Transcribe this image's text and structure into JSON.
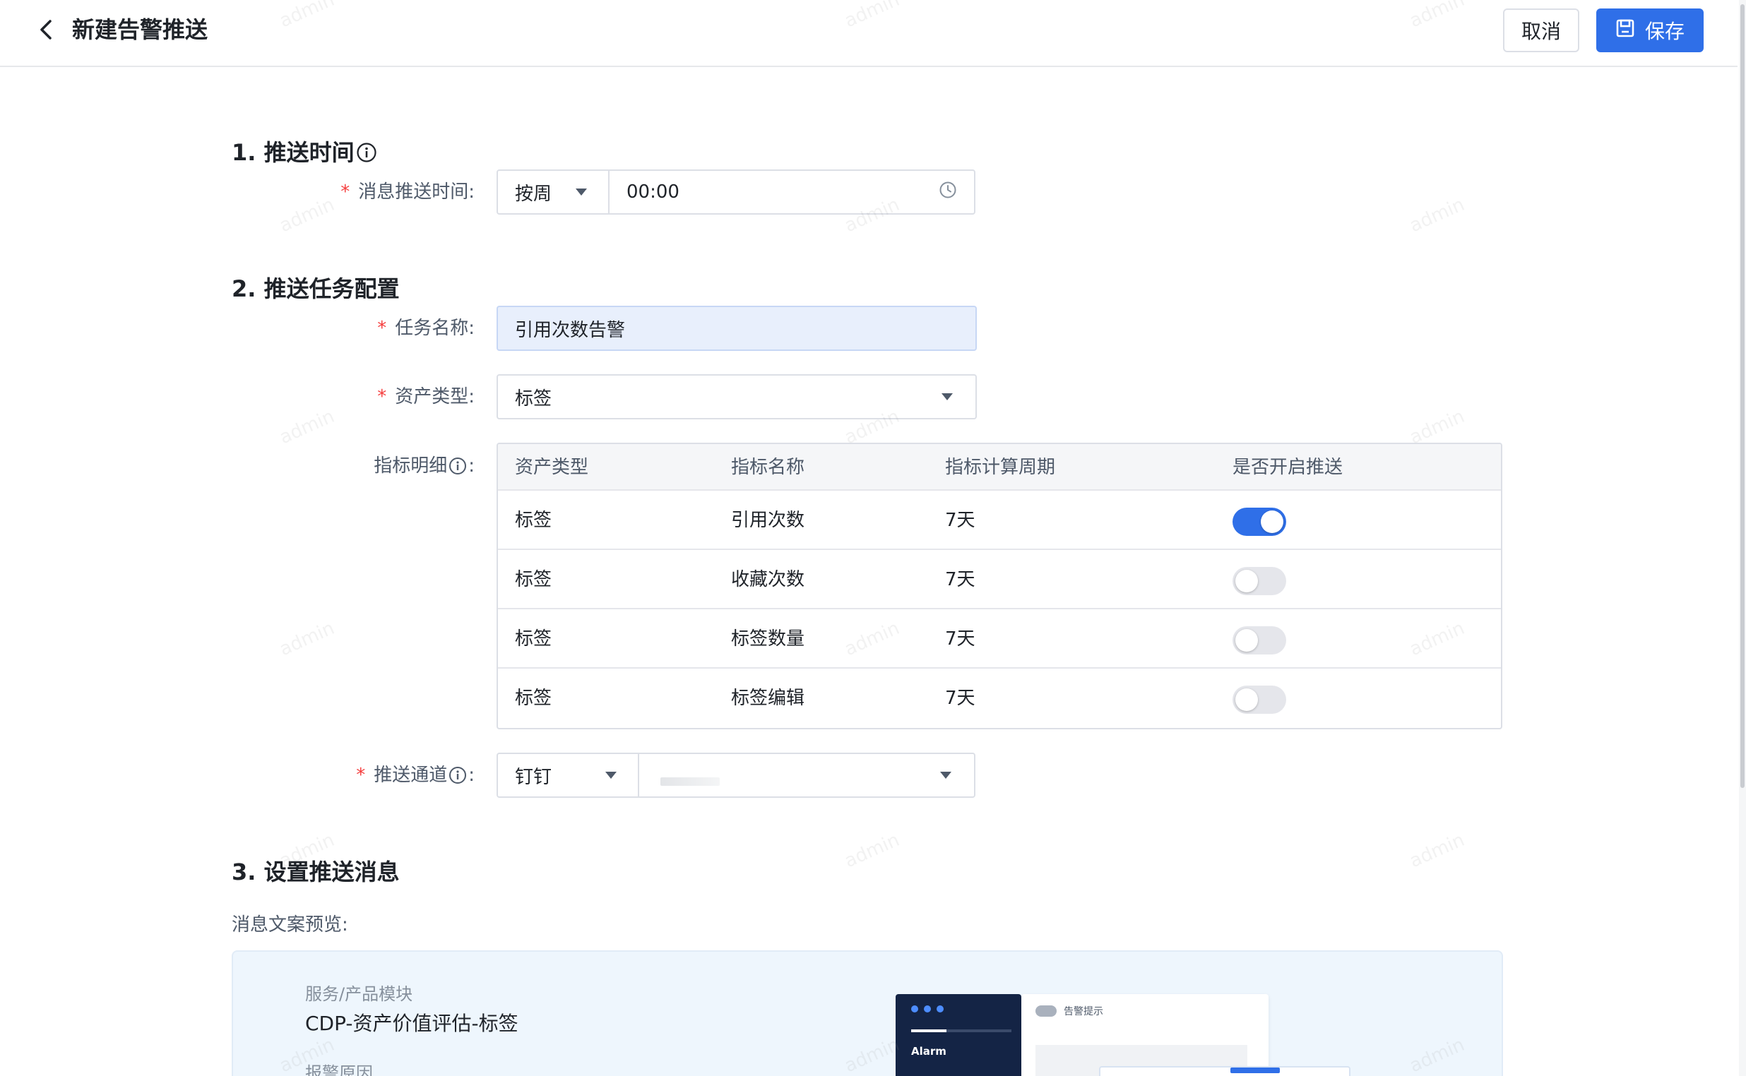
{
  "header": {
    "title": "新建告警推送",
    "cancel_label": "取消",
    "save_label": "保存"
  },
  "sections": {
    "push_time": {
      "title": "1. 推送时间"
    },
    "task_config": {
      "title": "2. 推送任务配置"
    },
    "message": {
      "title": "3. 设置推送消息"
    }
  },
  "form": {
    "push_time": {
      "label": "消息推送时间:",
      "frequency": "按周",
      "time": "00:00"
    },
    "task_name": {
      "label": "任务名称:",
      "value": "引用次数告警"
    },
    "asset_type": {
      "label": "资产类型:",
      "value": "标签"
    },
    "metric_detail": {
      "label": "指标明细"
    },
    "channel": {
      "label": "推送通道",
      "value": "钉钉"
    }
  },
  "metric_table": {
    "columns": [
      "资产类型",
      "指标名称",
      "指标计算周期",
      "是否开启推送"
    ],
    "rows": [
      {
        "asset_type": "标签",
        "metric": "引用次数",
        "period": "7天",
        "enabled": true
      },
      {
        "asset_type": "标签",
        "metric": "收藏次数",
        "period": "7天",
        "enabled": false
      },
      {
        "asset_type": "标签",
        "metric": "标签数量",
        "period": "7天",
        "enabled": false
      },
      {
        "asset_type": "标签",
        "metric": "标签编辑",
        "period": "7天",
        "enabled": false
      }
    ]
  },
  "preview": {
    "label": "消息文案预览:",
    "service_label": "服务/产品模块",
    "service_value": "CDP-资产价值评估-标签",
    "reason_label": "报警原因",
    "mock_app_title": "Alarm",
    "mock_alert_title": "告警提示"
  },
  "watermark_text": "admin",
  "colors": {
    "primary": "#2f6fe8",
    "required": "#f53f3f",
    "preview_bg": "#eef6fd"
  }
}
